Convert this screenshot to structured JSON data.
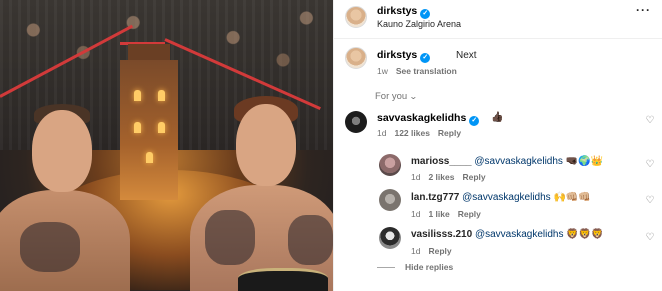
{
  "post": {
    "author": "dirkstys",
    "location": "Kauno Zalgirio Arena",
    "caption": {
      "username": "dirkstys",
      "text": "Next",
      "age": "1w",
      "translate": "See translation"
    }
  },
  "sort_label": "For you",
  "comments": [
    {
      "username": "savvaskagkelidhs",
      "text": "👍🏿",
      "age": "1d",
      "likes": "122 likes",
      "reply": "Reply"
    }
  ],
  "replies": [
    {
      "username": "marioss____",
      "mention": "@savvaskagkelidhs",
      "text": "🤜🏿🌍👑",
      "age": "1d",
      "likes": "2 likes",
      "reply": "Reply"
    },
    {
      "username": "lan.tzg777",
      "mention": "@savvaskagkelidhs",
      "text": "🙌👊🏼👊🏼",
      "age": "1d",
      "likes": "1 like",
      "reply": "Reply"
    },
    {
      "username": "vasilisss.210",
      "mention": "@savvaskagkelidhs",
      "text": "🦁🦁🦁",
      "age": "1d",
      "reply": "Reply"
    }
  ],
  "hide_replies": "Hide replies",
  "icons": {
    "more": "more-options-icon",
    "verified": "verified-badge-icon",
    "heart": "heart-icon",
    "chevron": "chevron-down-icon"
  },
  "colors": {
    "link": "#00376b",
    "verified": "#0095f6",
    "secondary": "#737373"
  }
}
